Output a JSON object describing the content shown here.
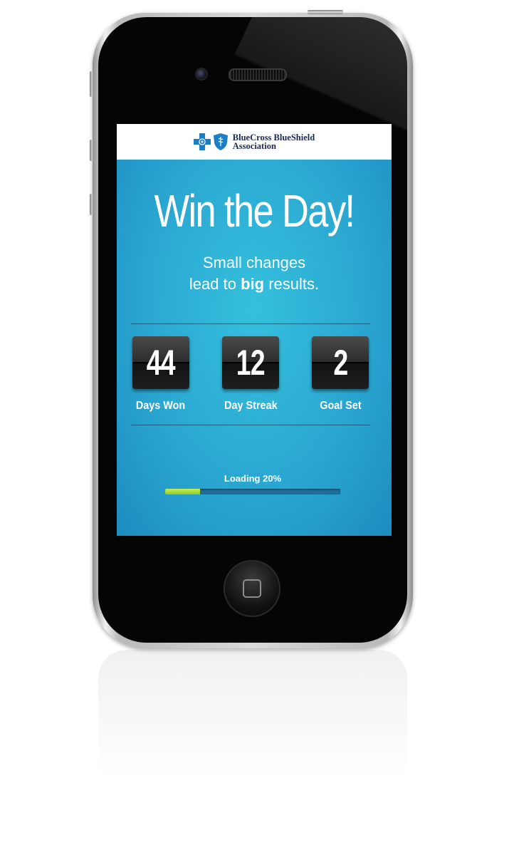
{
  "header": {
    "brand_line1": "BlueCross BlueShield",
    "brand_line2": "Association"
  },
  "hero": {
    "title": "Win the Day!",
    "subtitle_part1": "Small",
    "subtitle_part2": "changes",
    "subtitle_part3": "lead to",
    "subtitle_part4": "big",
    "subtitle_part5": "results."
  },
  "stats": [
    {
      "value": "44",
      "label": "Days Won"
    },
    {
      "value": "12",
      "label": "Day Streak"
    },
    {
      "value": "2",
      "label": "Goal Set"
    }
  ],
  "loading": {
    "label": "Loading 20%",
    "progress": 0.2
  },
  "colors": {
    "screen_bg": "#2aa7d1",
    "progress_fill": "#8ccc25",
    "brand_blue": "#1a7fc4"
  },
  "icons": [
    "blue-cross-icon",
    "blue-shield-icon",
    "home-button-icon"
  ]
}
